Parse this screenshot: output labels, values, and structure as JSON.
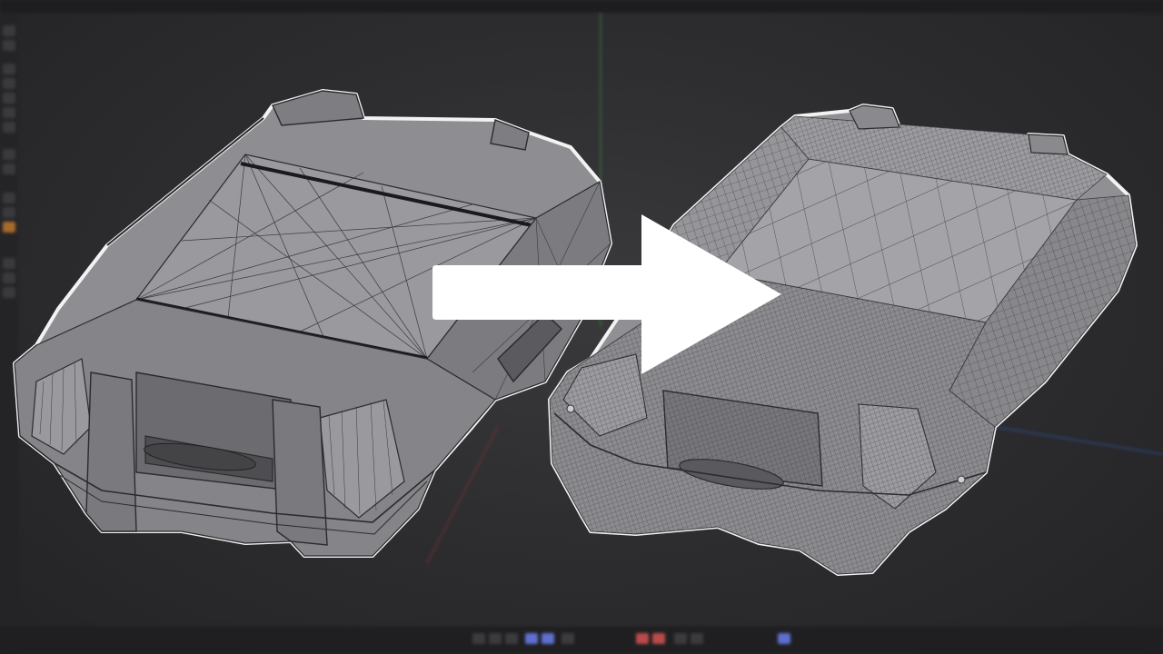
{
  "window": {
    "type": "3d-viewport"
  },
  "icons": {
    "arrow": "right-arrow-icon",
    "case_left": "triangulated-case-mesh",
    "case_right": "quad-topology-case-mesh"
  },
  "colors": {
    "background": "#2e2e31",
    "mesh_fill": "#8e8e92",
    "mesh_dark": "#5b5b5f",
    "wire": "#2b2b2d",
    "outline": "#f2f2f2",
    "arrow": "#ffffff",
    "axis_green": "#3f7a3a",
    "axis_red": "#7a3333",
    "axis_blue": "#2f4f8a",
    "accent_button": "#5f6fcf"
  }
}
